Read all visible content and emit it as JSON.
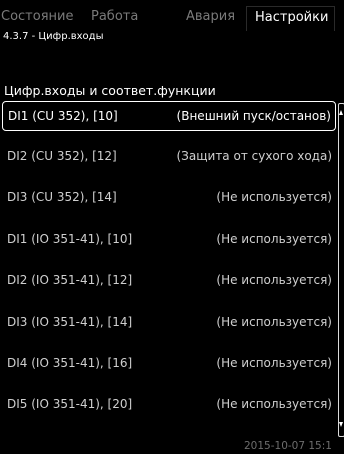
{
  "tabs": [
    {
      "label": "Состояние"
    },
    {
      "label": "Работа"
    },
    {
      "label": "Авария"
    },
    {
      "label": "Настройки"
    }
  ],
  "breadcrumb": "4.3.7 - Цифр.входы",
  "section_title": "Цифр.входы и соответ.функции",
  "rows": [
    {
      "name": "DI1 (CU 352), [10]",
      "function": "(Внешний пуск/останов)"
    },
    {
      "name": "DI2 (CU 352), [12]",
      "function": "(Защита от сухого хода)"
    },
    {
      "name": "DI3 (CU 352), [14]",
      "function": "(Не используется)"
    },
    {
      "name": "DI1 (IO 351-41), [10]",
      "function": "(Не используется)"
    },
    {
      "name": "DI2 (IO 351-41), [12]",
      "function": "(Не используется)"
    },
    {
      "name": "DI3 (IO 351-41), [14]",
      "function": "(Не используется)"
    },
    {
      "name": "DI4 (IO 351-41), [16]",
      "function": "(Не используется)"
    },
    {
      "name": "DI5 (IO 351-41), [20]",
      "function": "(Не используется)"
    }
  ],
  "datetime": "2015-10-07 15:1"
}
